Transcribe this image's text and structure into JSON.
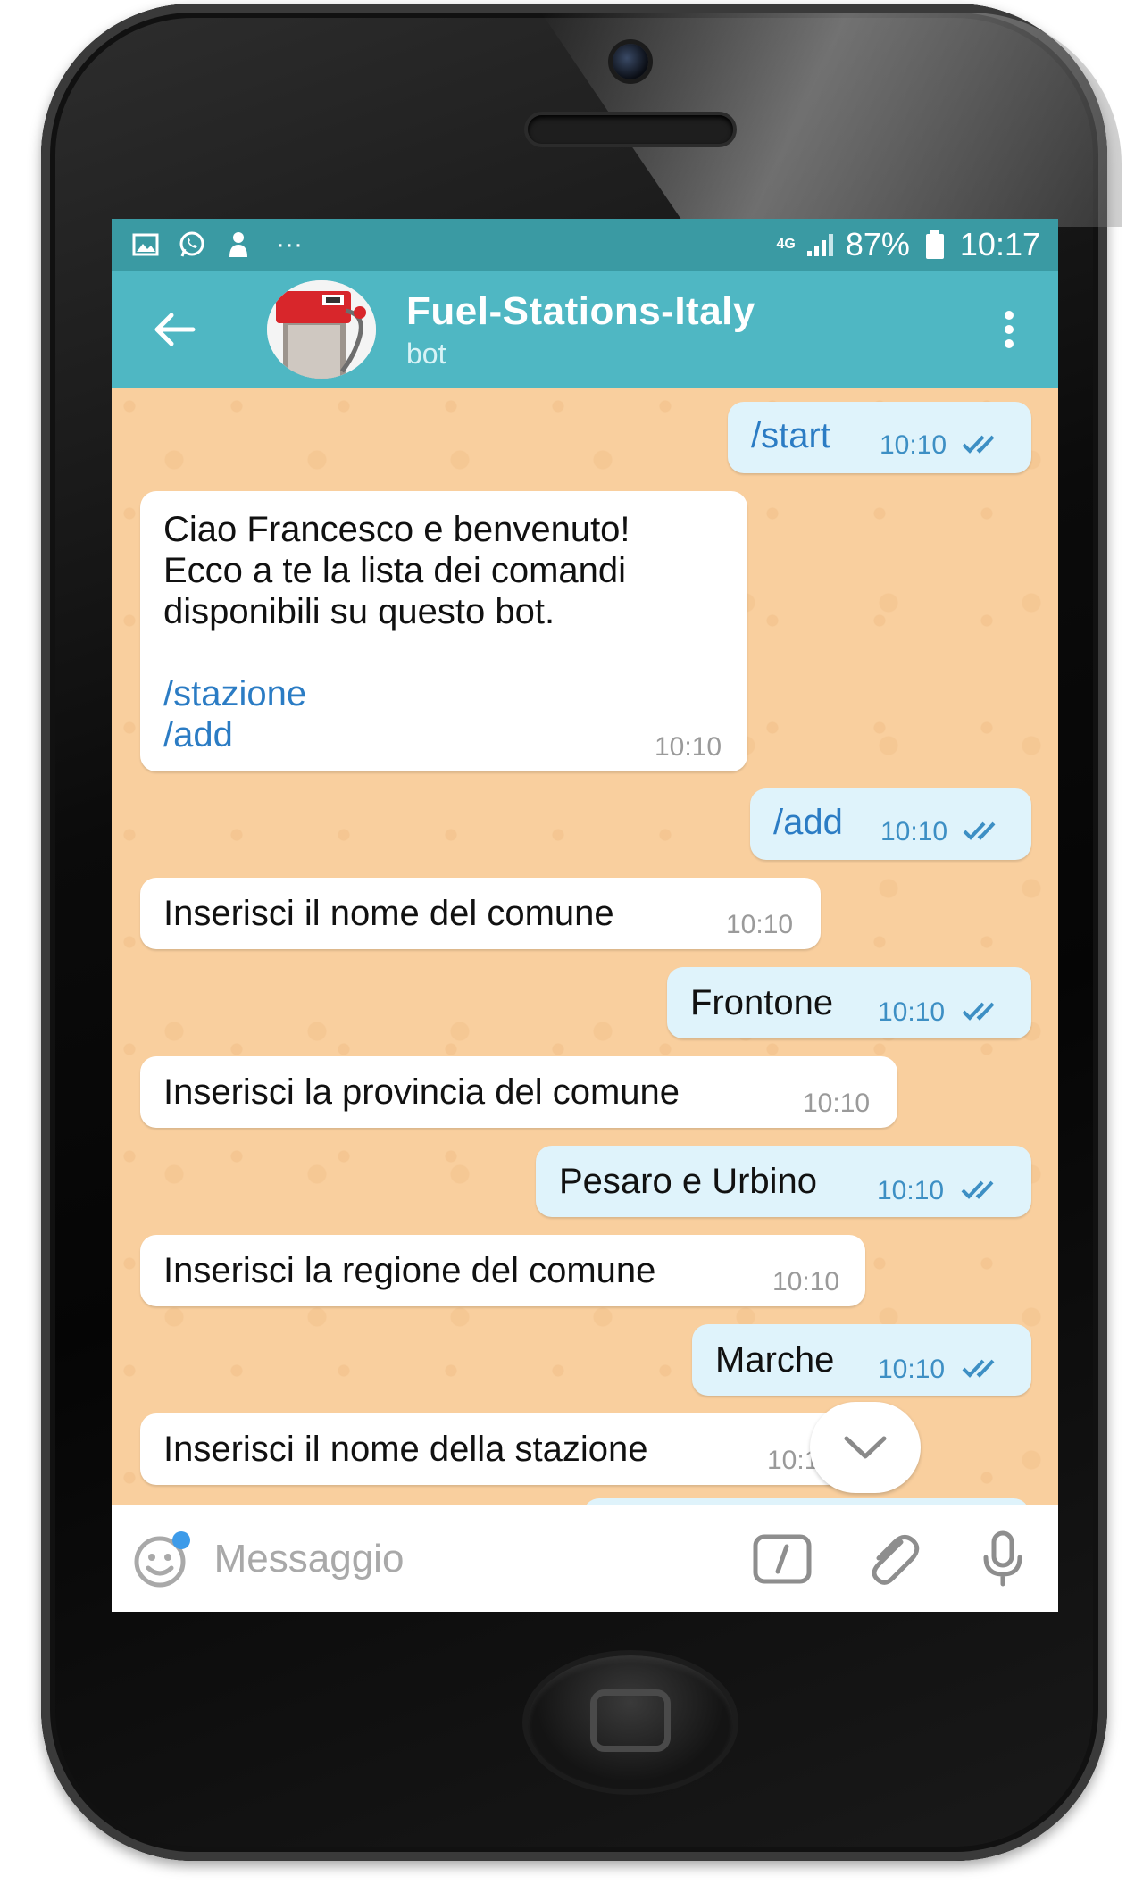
{
  "status_bar": {
    "network": "4G",
    "battery": "87%",
    "time": "10:17",
    "more": "···"
  },
  "header": {
    "title": "Fuel-Stations-Italy",
    "subtitle": "bot"
  },
  "messages": [
    {
      "dir": "out",
      "text": "/start",
      "time": "10:10"
    },
    {
      "dir": "in",
      "lines": [
        "Ciao Francesco e benvenuto!",
        "Ecco a te la lista dei comandi",
        "disponibili su questo bot."
      ],
      "commands": [
        "/stazione",
        "/add"
      ],
      "time": "10:10"
    },
    {
      "dir": "out",
      "text": "/add",
      "time": "10:10"
    },
    {
      "dir": "in",
      "text": "Inserisci il nome del comune",
      "time": "10:10"
    },
    {
      "dir": "out",
      "text": "Frontone",
      "time": "10:10"
    },
    {
      "dir": "in",
      "text": "Inserisci la provincia del comune",
      "time": "10:10"
    },
    {
      "dir": "out",
      "text": "Pesaro e Urbino",
      "time": "10:10"
    },
    {
      "dir": "in",
      "text": "Inserisci la regione del comune",
      "time": "10:10"
    },
    {
      "dir": "out",
      "text": "Marche",
      "time": "10:10"
    },
    {
      "dir": "in",
      "text": "Inserisci il nome della stazione",
      "time": "10:10"
    }
  ],
  "input": {
    "placeholder": "Messaggio"
  },
  "icons": {
    "back": "arrow-left-icon",
    "menu": "more-vertical-icon",
    "emoji": "emoji-icon",
    "command": "slash-command-icon",
    "attach": "paperclip-icon",
    "mic": "microphone-icon",
    "scroll": "chevron-down-icon"
  },
  "colors": {
    "status_bar": "#3a9aa3",
    "app_bar": "#4fb7c3",
    "chat_background": "#f9cf9e",
    "outgoing_bubble": "#dff3fb",
    "incoming_bubble": "#ffffff",
    "command_link": "#2b7cc4"
  }
}
